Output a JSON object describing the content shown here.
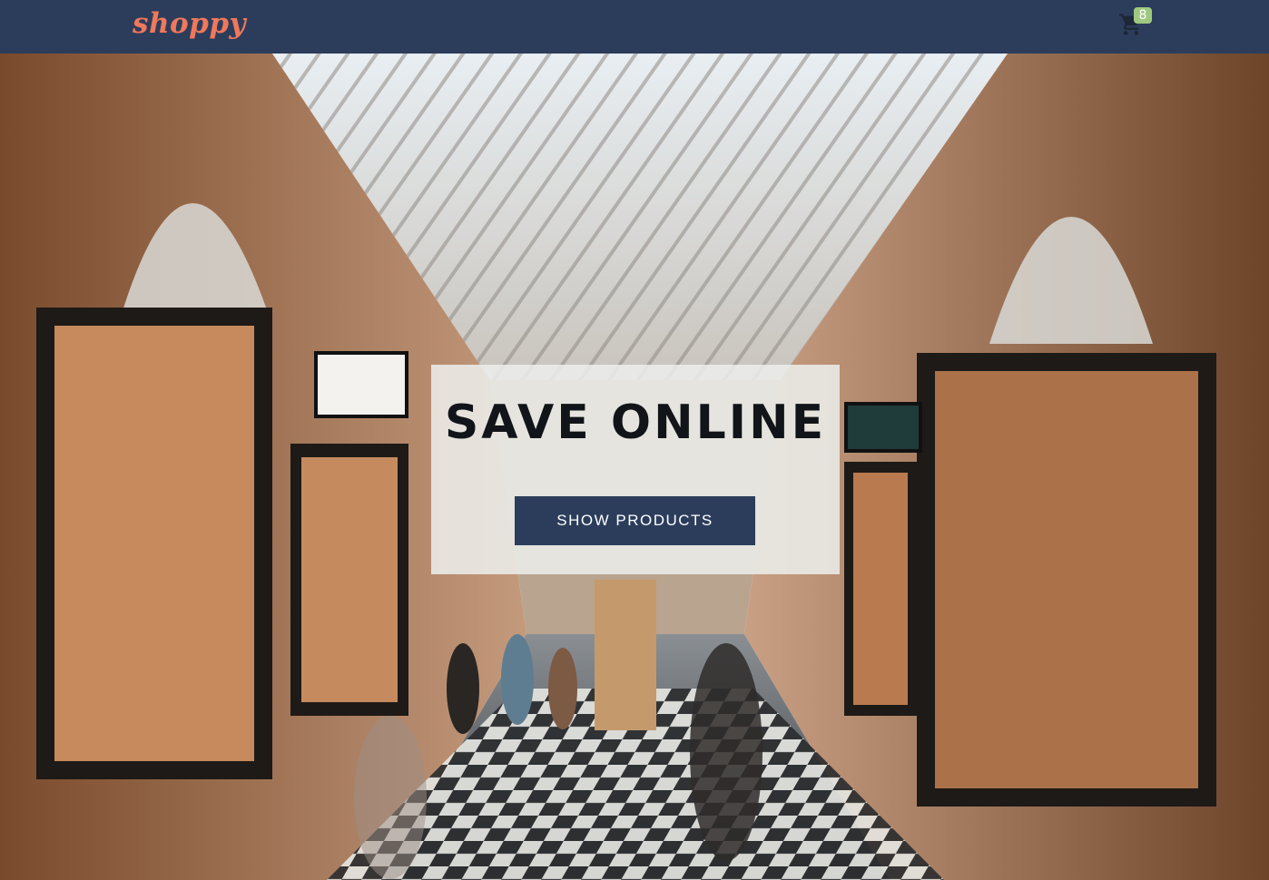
{
  "header": {
    "logo_text": "shoppy",
    "cart": {
      "icon": "cart-icon",
      "count": "8",
      "badge_color": "#9ec97f"
    },
    "background_color": "#2c3d5c",
    "logo_color": "#f0785b"
  },
  "hero": {
    "background_image": "shopping-arcade-photo",
    "title": "SAVE ONLINE",
    "button_label": "SHOW PRODUCTS",
    "button_color": "#2c3d5c"
  }
}
